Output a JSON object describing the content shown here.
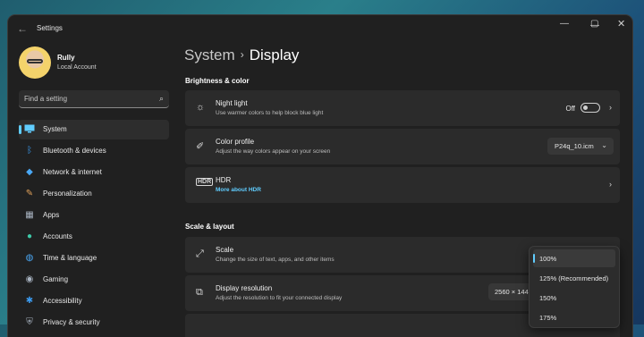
{
  "window": {
    "title": "Settings"
  },
  "user": {
    "name": "Rully",
    "account": "Local Account"
  },
  "search": {
    "placeholder": "Find a setting"
  },
  "sidebar": {
    "items": [
      {
        "label": "System",
        "icon": "monitor-icon",
        "active": true
      },
      {
        "label": "Bluetooth & devices",
        "icon": "bluetooth-icon"
      },
      {
        "label": "Network & internet",
        "icon": "wifi-icon"
      },
      {
        "label": "Personalization",
        "icon": "brush-icon"
      },
      {
        "label": "Apps",
        "icon": "apps-icon"
      },
      {
        "label": "Accounts",
        "icon": "person-icon"
      },
      {
        "label": "Time & language",
        "icon": "globe-icon"
      },
      {
        "label": "Gaming",
        "icon": "gamepad-icon"
      },
      {
        "label": "Accessibility",
        "icon": "accessibility-icon"
      },
      {
        "label": "Privacy & security",
        "icon": "shield-icon"
      }
    ]
  },
  "breadcrumb": {
    "parent": "System",
    "separator": "›",
    "current": "Display"
  },
  "sections": {
    "brightness": "Brightness & color",
    "scale_layout": "Scale & layout"
  },
  "night_light": {
    "title": "Night light",
    "subtitle": "Use warmer colors to help block blue light",
    "state": "Off"
  },
  "color_profile": {
    "title": "Color profile",
    "subtitle": "Adjust the way colors appear on your screen",
    "value": "P24q_10.icm"
  },
  "hdr": {
    "title": "HDR",
    "link": "More about HDR"
  },
  "scale": {
    "title": "Scale",
    "subtitle": "Change the size of text, apps, and other items"
  },
  "resolution": {
    "title": "Display resolution",
    "subtitle": "Adjust the resolution to fit your connected display",
    "value": "2560 × 1440"
  },
  "scale_options": {
    "options": [
      "100%",
      "125% (Recommended)",
      "150%",
      "175%"
    ],
    "selected": "100%"
  },
  "colors": {
    "accent": "#60cdff",
    "background": "#202020",
    "card": "#2b2b2b"
  }
}
